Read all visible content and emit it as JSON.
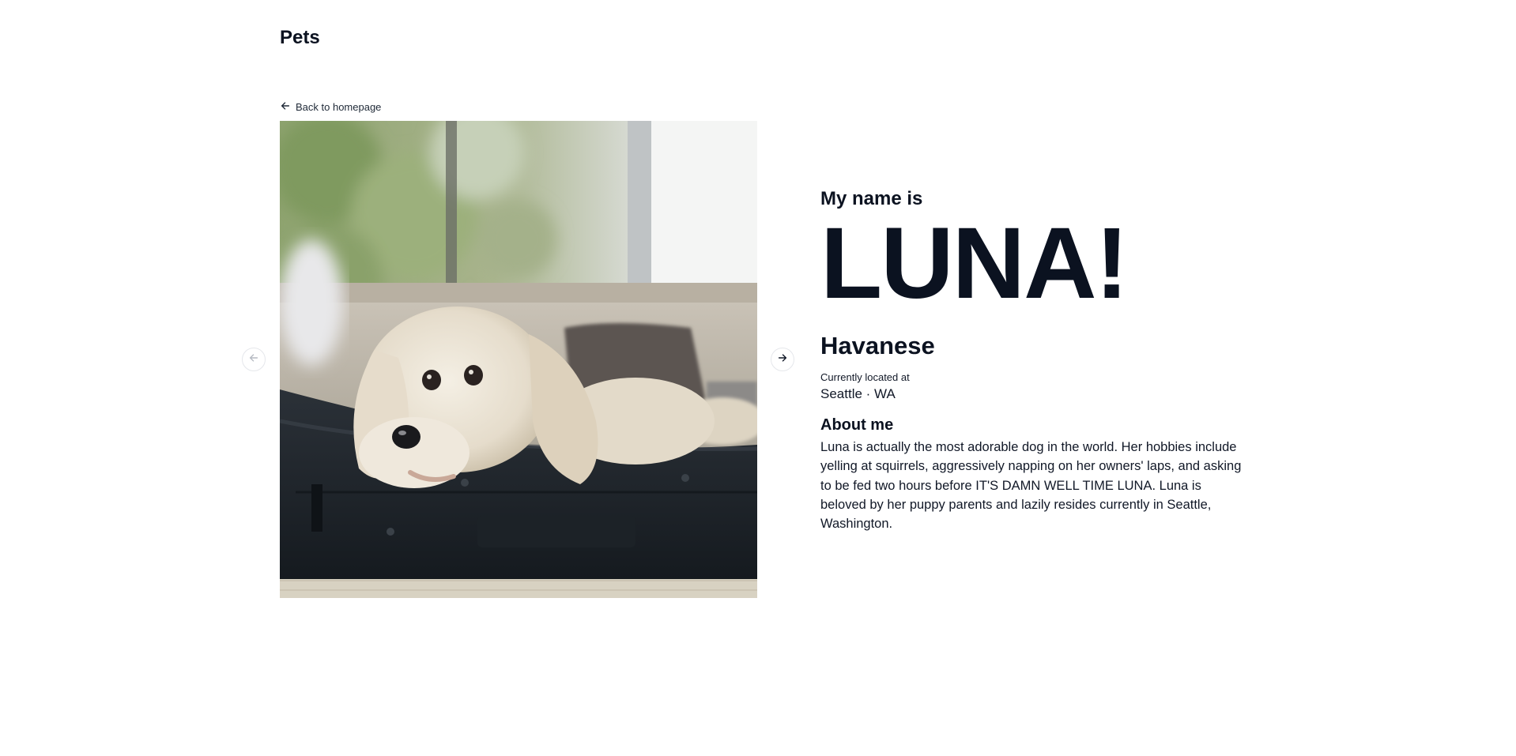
{
  "header": {
    "site_title": "Pets"
  },
  "nav": {
    "back_label": "Back to homepage"
  },
  "icons": {
    "back": "arrow-left-icon",
    "prev": "arrow-left-icon",
    "next": "arrow-right-icon"
  },
  "photo": {
    "subject": "small white Havanese dog resting in an open black suitcase"
  },
  "pet": {
    "intro": "My name is",
    "name": "LUNA!",
    "breed": "Havanese",
    "location_label": "Currently located at",
    "location": "Seattle · WA",
    "about_heading": "About me",
    "about_text": "Luna is actually the most adorable dog in the world. Her hobbies include yelling at squirrels, aggressively napping on her owners' laps, and asking to be fed two hours before IT'S DAMN WELL TIME LUNA. Luna is beloved by her puppy parents and lazily resides currently in Seattle, Washington."
  },
  "colors": {
    "text": "#0b1220",
    "background": "#ffffff",
    "disabled_icon": "#b6bac2"
  }
}
